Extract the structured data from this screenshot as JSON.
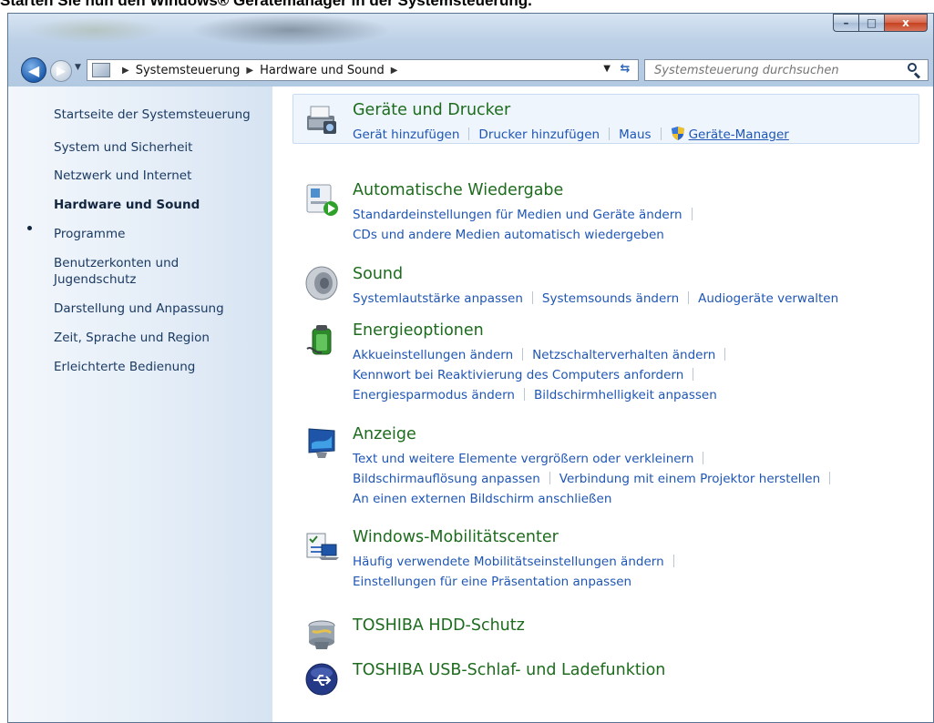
{
  "caption": "Starten Sie nun den Windows® Gerätemanager in der Systemsteuerung.",
  "window": {
    "buttons": {
      "minimize": "–",
      "maximize": "□",
      "close": "x"
    }
  },
  "navbar": {
    "back_icon": "back-arrow-icon",
    "forward_icon": "forward-arrow-icon",
    "breadcrumb": [
      "Systemsteuerung",
      "Hardware und Sound"
    ],
    "search_placeholder": "Systemsteuerung durchsuchen"
  },
  "sidebar": {
    "items": [
      {
        "label": "Startseite der Systemsteuerung"
      },
      {
        "label": "System und Sicherheit"
      },
      {
        "label": "Netzwerk und Internet"
      },
      {
        "label": "Hardware und Sound",
        "active": true
      },
      {
        "label": "Programme"
      },
      {
        "label": "Benutzerkonten und"
      },
      {
        "label": "Jugendschutz"
      },
      {
        "label": "Darstellung und Anpassung"
      },
      {
        "label": "Zeit, Sprache und Region"
      },
      {
        "label": "Erleichterte Bedienung"
      }
    ]
  },
  "categories": [
    {
      "title": "Geräte und Drucker",
      "icon": "printer-icon",
      "lines": [
        [
          "Gerät hinzufügen",
          "Drucker hinzufügen",
          "Maus",
          "Geräte-Manager"
        ]
      ]
    },
    {
      "title": "Automatische Wiedergabe",
      "icon": "autoplay-icon",
      "lines": [
        [
          "Standardeinstellungen für Medien und Geräte ändern"
        ],
        [
          "CDs und andere Medien automatisch wiedergeben"
        ]
      ]
    },
    {
      "title": "Sound",
      "icon": "speaker-icon",
      "lines": [
        [
          "Systemlautstärke anpassen",
          "Systemsounds ändern",
          "Audiogeräte verwalten"
        ]
      ]
    },
    {
      "title": "Energieoptionen",
      "icon": "battery-icon",
      "lines": [
        [
          "Akkueinstellungen ändern",
          "Netzschalterverhalten ändern"
        ],
        [
          "Kennwort bei Reaktivierung des Computers anfordern"
        ],
        [
          "Energiesparmodus ändern",
          "Bildschirmhelligkeit anpassen"
        ]
      ]
    },
    {
      "title": "Anzeige",
      "icon": "display-icon",
      "lines": [
        [
          "Text und weitere Elemente vergrößern oder verkleinern"
        ],
        [
          "Bildschirmauflösung anpassen",
          "Verbindung mit einem Projektor herstellen"
        ],
        [
          "An einen externen Bildschirm anschließen"
        ]
      ]
    },
    {
      "title": "Windows-Mobilitätscenter",
      "icon": "mobility-center-icon",
      "lines": [
        [
          "Häufig verwendete Mobilitätseinstellungen ändern"
        ],
        [
          "Einstellungen für eine Präsentation anpassen"
        ]
      ]
    },
    {
      "title": "TOSHIBA HDD-Schutz",
      "icon": "hdd-protection-icon",
      "lines": []
    },
    {
      "title": "TOSHIBA USB-Schlaf- und Ladefunktion",
      "icon": "usb-icon",
      "lines": []
    }
  ]
}
